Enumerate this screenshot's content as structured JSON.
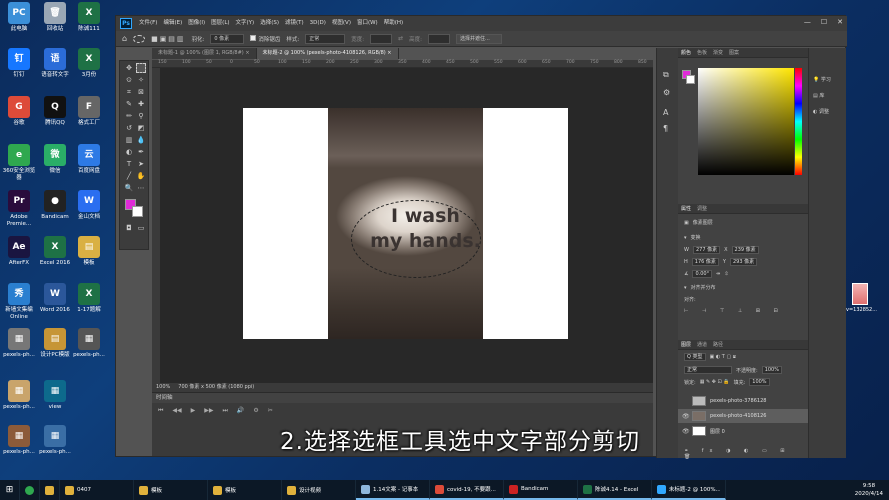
{
  "desktop": {
    "icons": [
      {
        "label": "此电脑",
        "color": "#3b8fd8",
        "glyph": "PC"
      },
      {
        "label": "回收站",
        "color": "#9aa7b5",
        "glyph": "🗑"
      },
      {
        "label": "陈诚111",
        "color": "#1e7145",
        "glyph": "X"
      },
      {
        "label": "钉钉",
        "color": "#1677ff",
        "glyph": "钉"
      },
      {
        "label": "语音转文字",
        "color": "#2b6cd8",
        "glyph": "语"
      },
      {
        "label": "3月份",
        "color": "#1e7145",
        "glyph": "X"
      },
      {
        "label": "谷歌",
        "color": "#dd4b39",
        "glyph": "G"
      },
      {
        "label": "腾讯QQ",
        "color": "#111",
        "glyph": "Q"
      },
      {
        "label": "格式工厂",
        "color": "#666",
        "glyph": "F"
      },
      {
        "label": "360安全浏览器",
        "color": "#2fa84f",
        "glyph": "e"
      },
      {
        "label": "微信",
        "color": "#2aae67",
        "glyph": "微"
      },
      {
        "label": "百度网盘",
        "color": "#2d7ae5",
        "glyph": "云"
      },
      {
        "label": "Adobe Premie...",
        "color": "#2a0c3c",
        "glyph": "Pr"
      },
      {
        "label": "Bandicam",
        "color": "#222",
        "glyph": "●"
      },
      {
        "label": "金山文档",
        "color": "#2a6ef0",
        "glyph": "W"
      },
      {
        "label": "AfterFX",
        "color": "#1a1540",
        "glyph": "Ae"
      },
      {
        "label": "Excel 2016",
        "color": "#1e7145",
        "glyph": "X"
      },
      {
        "label": "模板",
        "color": "#d9b043",
        "glyph": "▤"
      },
      {
        "label": "新墙文集编Online",
        "color": "#2a7fd0",
        "glyph": "秀"
      },
      {
        "label": "Word 2016",
        "color": "#2b579a",
        "glyph": "W"
      },
      {
        "label": "1-17题解",
        "color": "#1e7145",
        "glyph": "X"
      },
      {
        "label": "pexels-ph...",
        "color": "#777",
        "glyph": "▦"
      },
      {
        "label": "设计PC模版",
        "color": "#c69536",
        "glyph": "▤"
      },
      {
        "label": "pexels-ph...",
        "color": "#555",
        "glyph": "▦"
      },
      {
        "label": "pexels-ph...",
        "color": "#c9a46b",
        "glyph": "▦"
      },
      {
        "label": "view",
        "color": "#0d6a8c",
        "glyph": "▦"
      },
      {
        "label": "pexels-ph...",
        "color": "#8c5b3a",
        "glyph": "▦"
      },
      {
        "label": "pexels-ph...",
        "color": "#3a6ea5",
        "glyph": "▦"
      }
    ],
    "right_thumb_label": "v=132852..."
  },
  "photoshop": {
    "menu": [
      "文件(F)",
      "编辑(E)",
      "图像(I)",
      "图层(L)",
      "文字(Y)",
      "选择(S)",
      "滤镜(T)",
      "3D(D)",
      "视图(V)",
      "窗口(W)",
      "帮助(H)"
    ],
    "logo": "Ps",
    "window_controls": [
      "—",
      "☐",
      "✕"
    ],
    "options": {
      "feather_label": "羽化:",
      "feather_value": "0 像素",
      "antialias_label": "消除锯齿",
      "style_label": "样式:",
      "style_value": "正常",
      "width_label": "宽度:",
      "height_label": "高度:",
      "select_subject": "选择并遮住..."
    },
    "tabs": [
      {
        "label": "未标题-1 @ 100% (图层 1, RGB/8#) ×",
        "active": false
      },
      {
        "label": "未标题-2 @ 100% (pexels-photo-4108126, RGB/8) ×",
        "active": true
      }
    ],
    "ruler_marks": [
      "150",
      "100",
      "50",
      "0",
      "50",
      "100",
      "150",
      "200",
      "250",
      "300",
      "350",
      "400",
      "450",
      "500",
      "550",
      "600",
      "650",
      "700",
      "750",
      "800",
      "850"
    ],
    "canvas_text_line1": "I wash",
    "canvas_text_line2": "my hands.",
    "status": {
      "zoom": "100%",
      "doc_size": "700 像素 x 500 像素 (1080 ppi)"
    },
    "timeline": {
      "title": "时间轴",
      "controls": [
        "⏮",
        "◀◀",
        "▶",
        "▶▶",
        "⏭",
        "🔊",
        "⚙",
        "✂"
      ]
    },
    "caption": "2.选择选框工具选中文字部分剪切",
    "panels": {
      "color_tabs": [
        "颜色",
        "色板",
        "渐变",
        "图案"
      ],
      "props_tabs": [
        "属性",
        "调整"
      ],
      "props_kind": "像素图层",
      "transform_label": "变换",
      "w_label": "W",
      "w_value": "277 像素",
      "h_label": "H",
      "h_value": "176 像素",
      "x_label": "X",
      "x_value": "239 像素",
      "y_label": "Y",
      "y_value": "293 像素",
      "angle_value": "0.00°",
      "align_label": "对齐并分布",
      "align_sub": "对齐:",
      "layers_tabs": [
        "图层",
        "通道",
        "路径"
      ],
      "kind_filter": "Q 类型",
      "blend_mode": "正常",
      "opacity_label": "不透明度:",
      "opacity_value": "100%",
      "lock_label": "锁定:",
      "fill_label": "填充:",
      "fill_value": "100%",
      "layers": [
        {
          "name": "pexels-photo-3786128",
          "selected": false,
          "visible": false
        },
        {
          "name": "pexels-photo-4108126",
          "selected": true,
          "visible": true
        },
        {
          "name": "图层 0",
          "selected": false,
          "visible": true
        }
      ],
      "learn_label": "学习",
      "libs_label": "库",
      "adjust_label": "调整"
    }
  },
  "taskbar": {
    "items": [
      {
        "label": "0407",
        "color": "#e0b13c",
        "open": false
      },
      {
        "label": "模板",
        "color": "#e0b13c",
        "open": false
      },
      {
        "label": "模板",
        "color": "#e0b13c",
        "open": false
      },
      {
        "label": "设计视频",
        "color": "#e0b13c",
        "open": false
      },
      {
        "label": "1.14文案 - 记事本",
        "color": "#8fb7dc",
        "open": true
      },
      {
        "label": "covid-19, 不要跟...",
        "color": "#dd4b39",
        "open": true
      },
      {
        "label": "Bandicam",
        "color": "#c22",
        "open": true
      },
      {
        "label": "陈诚4.14 - Excel",
        "color": "#1e7145",
        "open": true
      },
      {
        "label": "未标题-2 @ 100%...",
        "color": "#31a8ff",
        "open": true
      }
    ],
    "time": "9:58",
    "date": "2020/4/14"
  }
}
